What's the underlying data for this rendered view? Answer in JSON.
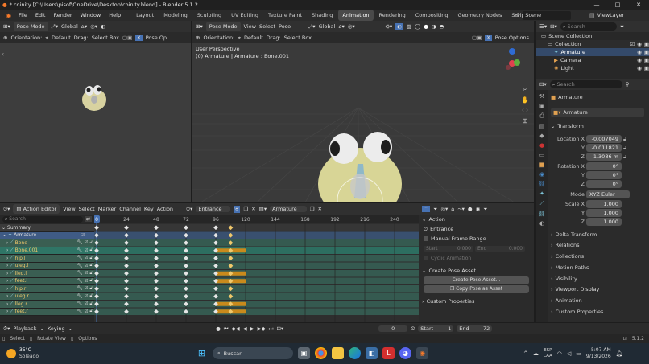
{
  "window": {
    "title": "* coinity [C:\\Users\\pisof\\OneDrive\\Desktop\\coinity.blend] - Blender 5.1.2",
    "minimize": "—",
    "maximize": "□",
    "close": "✕"
  },
  "menu": {
    "items": [
      "File",
      "Edit",
      "Render",
      "Window",
      "Help"
    ],
    "workspaces": [
      "Layout",
      "Modeling",
      "Sculpting",
      "UV Editing",
      "Texture Paint",
      "Shading",
      "Animation",
      "Rendering",
      "Compositing",
      "Geometry Nodes",
      "Scripting"
    ],
    "active_workspace": "Animation",
    "scene": "Scene",
    "view_layer": "ViewLayer"
  },
  "left_view": {
    "mode": "Pose Mode",
    "orientation_global": "Global",
    "orientation_label": "Orientation:",
    "orientation_value": "Default",
    "drag_label": "Drag:",
    "drag_value": "Select Box",
    "pose_opt": "Pose Op"
  },
  "main_view": {
    "mode": "Pose Mode",
    "menus": [
      "View",
      "Select",
      "Pose"
    ],
    "orientation_global": "Global",
    "orientation_label": "Orientation:",
    "orientation_value": "Default",
    "drag_label": "Drag:",
    "drag_value": "Select Box",
    "pose_options": "Pose Options",
    "info_line1": "User Perspective",
    "info_line2": "(0) Armature | Armature : Bone.001"
  },
  "outliner": {
    "search_placeholder": "Search",
    "items": [
      "Scene Collection",
      "Collection",
      "Armature",
      "Camera",
      "Light"
    ]
  },
  "properties": {
    "search_placeholder": "Search",
    "object_name": "Armature",
    "data_name": "Armature",
    "transform_title": "Transform",
    "location_x_label": "Location X",
    "location_x": "-0.007049",
    "location_y_label": "Y",
    "location_y": "-0.011821",
    "location_z_label": "Z",
    "location_z": "1.3086 m",
    "rotation_x_label": "Rotation X",
    "rotation_x": "0°",
    "rotation_y_label": "Y",
    "rotation_y": "0°",
    "rotation_z_label": "Z",
    "rotation_z": "0°",
    "mode_label": "Mode",
    "mode_value": "XYZ Euler",
    "scale_x_label": "Scale X",
    "scale_x": "1.000",
    "scale_y_label": "Y",
    "scale_y": "1.000",
    "scale_z_label": "Z",
    "scale_z": "1.000",
    "sections": [
      "Delta Transform",
      "Relations",
      "Collections",
      "Motion Paths",
      "Visibility",
      "Viewport Display",
      "Animation",
      "Custom Properties"
    ]
  },
  "action_editor": {
    "editor": "Action Editor",
    "menus": [
      "View",
      "Select",
      "Marker",
      "Channel",
      "Key",
      "Action"
    ],
    "action_name": "Entrance",
    "slot_name": "Armature",
    "search_placeholder": "Search",
    "frame_ticks": [
      "0",
      "24",
      "48",
      "72",
      "96",
      "120",
      "144",
      "168",
      "192",
      "216",
      "240"
    ],
    "current_frame_marker": "0",
    "channels": [
      "Summary",
      "Armature",
      "Bone",
      "Bone.001",
      "hip.l",
      "uleg.l",
      "lleg.l",
      "feet.l",
      "hip.r",
      "uleg.r",
      "lleg.r",
      "feet.r"
    ]
  },
  "action_panel": {
    "action_header": "Action",
    "action_name": "Entrance",
    "manual_frame_range": "Manual Frame Range",
    "start_label": "Start",
    "start_value": "0.000",
    "end_label": "End",
    "end_value": "0.000",
    "cyclic": "Cyclic Animation",
    "create_pose_asset_header": "Create Pose Asset",
    "create_pose_asset_btn": "Create Pose Asset...",
    "copy_pose_btn": "Copy Pose as Asset",
    "custom_properties": "Custom Properties"
  },
  "playback": {
    "playback": "Playback",
    "keying": "Keying",
    "current_frame": "0",
    "start_label": "Start",
    "start": "1",
    "end_label": "End",
    "end": "72"
  },
  "status": {
    "select": "Select",
    "rotate": "Rotate View",
    "options": "Options",
    "version": "5.1.2"
  },
  "taskbar": {
    "temperature": "35°C",
    "weather": "Soleado",
    "search_placeholder": "Buscar",
    "lang1": "ESP",
    "lang2": "LAA",
    "time": "5:07 AM",
    "date": "9/13/2026"
  },
  "colors": {
    "accent_blue": "#4772b3",
    "keyframe_selected": "#f1b43a",
    "selected_row": "#2f6b5a",
    "channel_row": "#3a5e52"
  }
}
